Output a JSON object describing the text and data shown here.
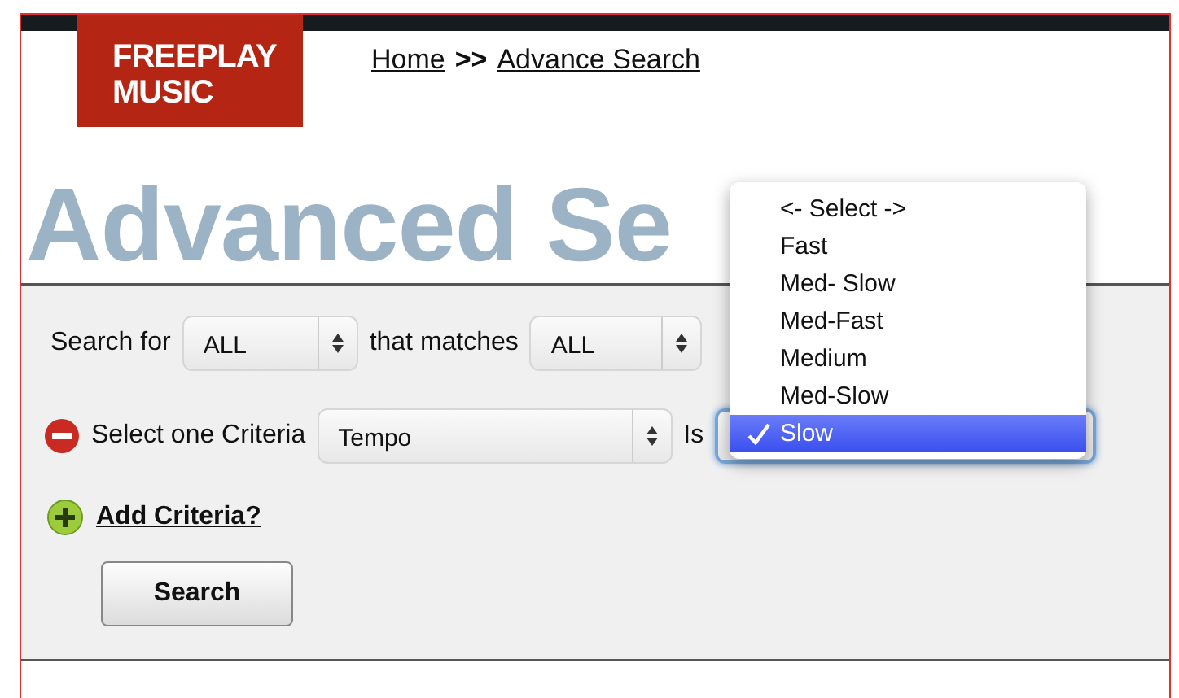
{
  "logo": {
    "lines": [
      "FREEPLAY",
      "MUSIC"
    ]
  },
  "breadcrumb": [
    {
      "kind": "link",
      "label": "Home"
    },
    {
      "kind": "separator",
      "label": ">>"
    },
    {
      "kind": "link",
      "label": "Advance Search"
    }
  ],
  "heading": "Advanced Se",
  "search_row": {
    "label": "Search for",
    "select": "ALL",
    "match_label": "that matches",
    "match_select": "ALL"
  },
  "criteria_row": {
    "label": "Select one Criteria",
    "field_select": "Tempo",
    "operator_label": "Is"
  },
  "add_criteria": "Add Criteria?",
  "search_button": "Search",
  "dropdown": {
    "options": [
      {
        "label": "<- Select ->",
        "selected": false
      },
      {
        "label": "Fast",
        "selected": false
      },
      {
        "label": "Med- Slow",
        "selected": false
      },
      {
        "label": "Med-Fast",
        "selected": false
      },
      {
        "label": "Medium",
        "selected": false
      },
      {
        "label": "Med-Slow",
        "selected": false
      },
      {
        "label": "Slow",
        "selected": true
      }
    ]
  }
}
